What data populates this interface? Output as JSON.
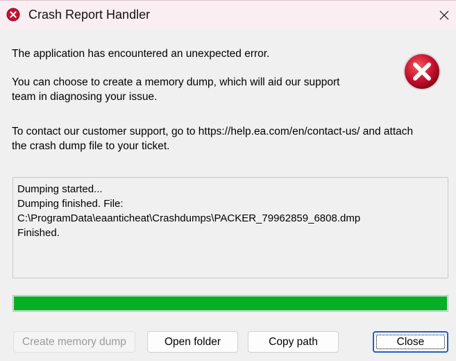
{
  "window": {
    "title": "Crash Report Handler",
    "title_icon": "error-icon",
    "close_icon": "close-icon"
  },
  "message": {
    "line1": "The application has encountered an unexpected error.",
    "line2a": "You can choose to create a memory dump, which will aid our support",
    "line2b": "team in diagnosing your issue.",
    "line3a": "To contact our customer support, go to https://help.ea.com/en/contact-us/ and attach",
    "line3b": "the crash dump file to your ticket.",
    "icon": "error-icon"
  },
  "log": {
    "lines": [
      "Dumping started...",
      "Dumping finished. File:",
      "C:\\ProgramData\\eaanticheat\\Crashdumps\\PACKER_79962859_6808.dmp",
      "Finished."
    ]
  },
  "progress": {
    "value": 1.0,
    "color": "#06b025"
  },
  "buttons": {
    "create_dump": "Create memory dump",
    "open_folder": "Open folder",
    "copy_path": "Copy path",
    "close": "Close"
  },
  "colors": {
    "titlebar": "#fbeef2",
    "error_red": "#c8102e",
    "focus_border": "#1f5fbf"
  }
}
